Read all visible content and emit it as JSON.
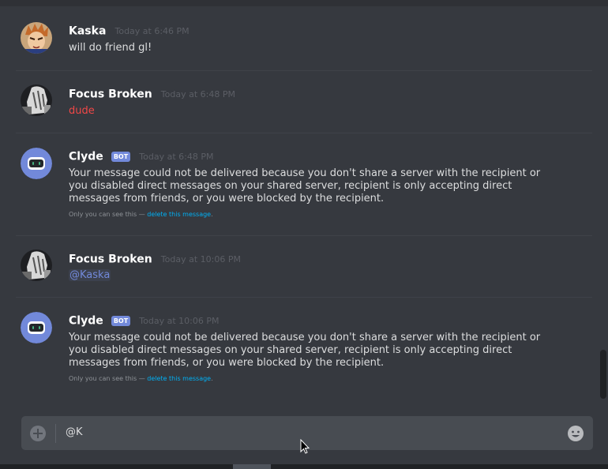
{
  "messages": [
    {
      "author": "Kaska",
      "timestamp": "Today at 6:46 PM",
      "avatar": "kaska-avatar",
      "text": "will do friend gl!"
    },
    {
      "author": "Focus Broken",
      "timestamp": "Today at 6:48 PM",
      "avatar": "focus-broken-avatar",
      "text": "dude"
    },
    {
      "author": "Clyde",
      "bot_tag": "BOT",
      "timestamp": "Today at 6:48 PM",
      "avatar": "clyde-avatar",
      "text": "Your message could not be delivered because you don't share a server with the recipient or you disabled direct messages on your shared server, recipient is only accepting direct messages from friends, or you were blocked by the recipient.",
      "ephemeral_note": "Only you can see this — ",
      "ephemeral_link": "delete this message"
    },
    {
      "author": "Focus Broken",
      "timestamp": "Today at 10:06 PM",
      "avatar": "focus-broken-avatar",
      "mention": "@Kaska"
    },
    {
      "author": "Clyde",
      "bot_tag": "BOT",
      "timestamp": "Today at 10:06 PM",
      "avatar": "clyde-avatar",
      "text": "Your message could not be delivered because you don't share a server with the recipient or you disabled direct messages on your shared server, recipient is only accepting direct messages from friends, or you were blocked by the recipient.",
      "ephemeral_note": "Only you can see this — ",
      "ephemeral_link": "delete this message"
    }
  ],
  "composer": {
    "value": "@K",
    "attach_icon": "plus-circle-icon",
    "emoji_icon": "smiley-icon"
  },
  "colors": {
    "background": "#36393f",
    "composer": "#484c52",
    "bot_tag": "#7289da",
    "mention": "#7289da",
    "error_text": "#f04747",
    "link": "#00b0f4"
  }
}
